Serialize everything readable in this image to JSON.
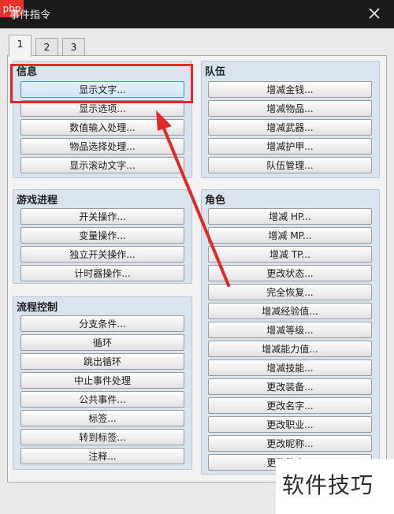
{
  "window": {
    "title": "事件指令",
    "badge": "php"
  },
  "tabs": [
    {
      "label": "1"
    },
    {
      "label": "2"
    },
    {
      "label": "3"
    }
  ],
  "groups": {
    "info": {
      "title": "信息",
      "buttons": [
        "显示文字...",
        "显示选项...",
        "数值输入处理...",
        "物品选择处理...",
        "显示滚动文字..."
      ]
    },
    "game": {
      "title": "游戏进程",
      "buttons": [
        "开关操作...",
        "变量操作...",
        "独立开关操作...",
        "计时器操作..."
      ]
    },
    "flow": {
      "title": "流程控制",
      "buttons": [
        "分支条件...",
        "循环",
        "跳出循环",
        "中止事件处理",
        "公共事件...",
        "标签...",
        "转到标签...",
        "注释..."
      ]
    },
    "party": {
      "title": "队伍",
      "buttons": [
        "增减金钱...",
        "增减物品...",
        "增减武器...",
        "增减护甲...",
        "队伍管理..."
      ]
    },
    "actor": {
      "title": "角色",
      "buttons": [
        "增减 HP...",
        "增减 MP...",
        "增减 TP...",
        "更改状态...",
        "完全恢复...",
        "增减经验值...",
        "增减等级...",
        "增减能力值...",
        "增减技能...",
        "更改装备...",
        "更改名字...",
        "更改职业...",
        "更改昵称...",
        "更改简介..."
      ]
    }
  },
  "watermark": {
    "text": "软件技巧"
  },
  "colors": {
    "highlight_box": "#e2282c",
    "group_bg": "#d9e4ef",
    "titlebar": "#1b1b1b"
  }
}
